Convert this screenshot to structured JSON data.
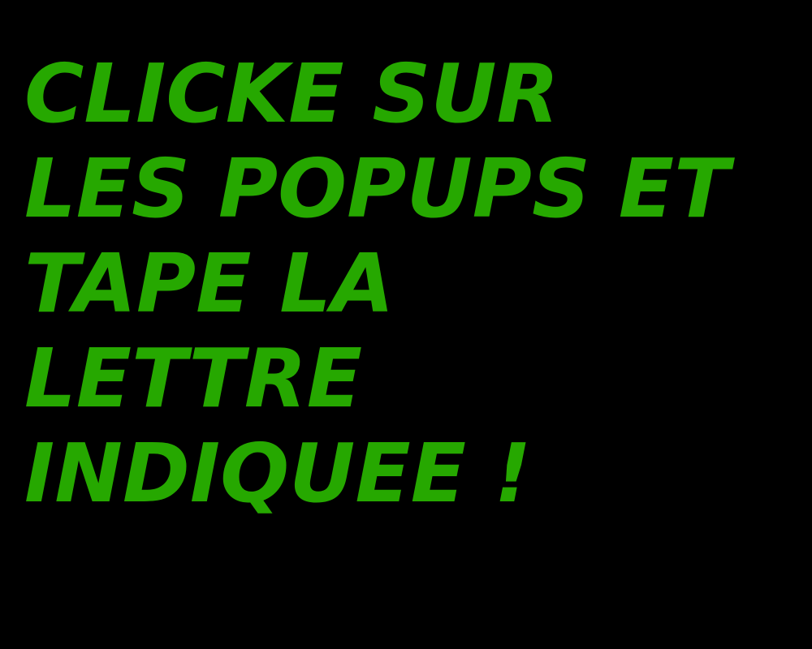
{
  "screen": {
    "background_color": "#000000",
    "text_color": "#26a800"
  },
  "instructions": {
    "lines": [
      "CLICKE SUR",
      "LES POPUPS ET",
      "TAPE LA",
      "LETTRE",
      "INDIQUEE !"
    ]
  }
}
